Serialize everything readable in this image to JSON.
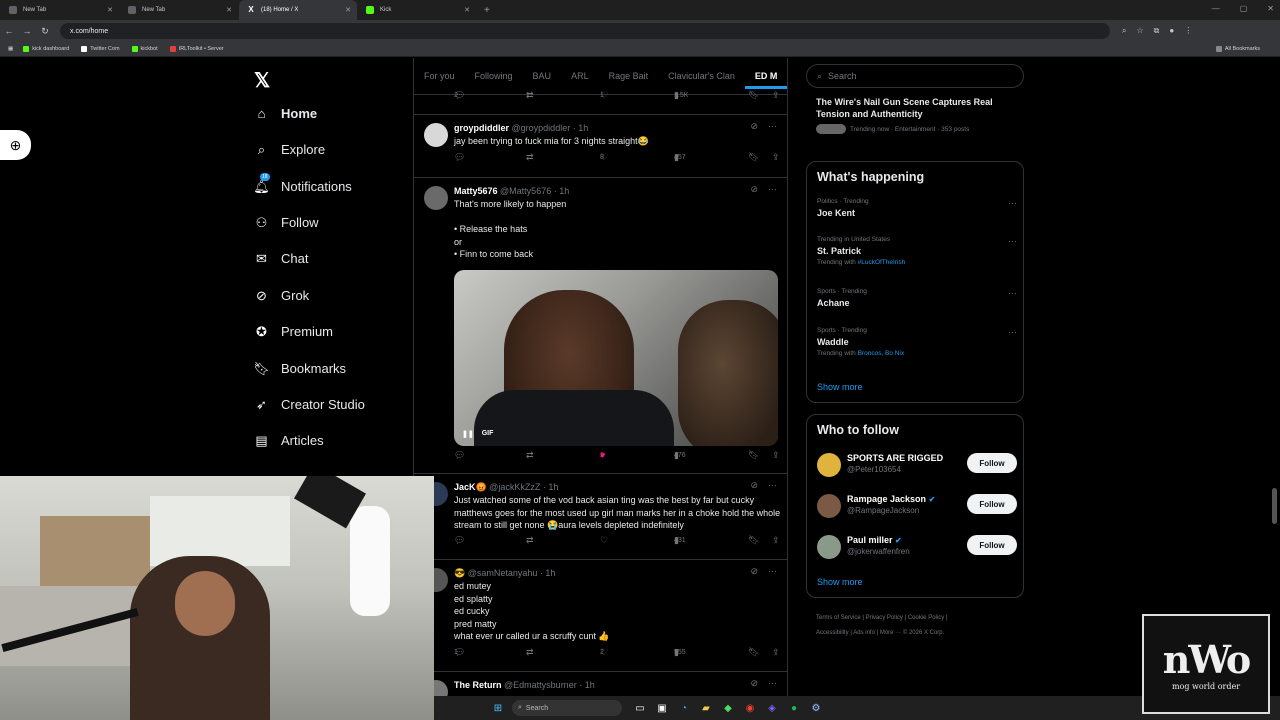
{
  "browser": {
    "tabs": [
      {
        "title": "New Tab",
        "active": false
      },
      {
        "title": "New Tab",
        "active": false
      },
      {
        "title": "(18) Home / X",
        "active": true
      },
      {
        "title": "Kick",
        "active": false
      }
    ],
    "url": "x.com/home",
    "bookmarks": [
      "kick dashboard",
      "Twitter Com",
      "kickbot",
      "IRLToolkit • Server"
    ],
    "all_bookmarks": "All Bookmarks"
  },
  "nav": {
    "items": [
      {
        "label": "Home",
        "icon": "home-icon"
      },
      {
        "label": "Explore",
        "icon": "search-icon"
      },
      {
        "label": "Notifications",
        "icon": "bell-icon",
        "badge": "18"
      },
      {
        "label": "Follow",
        "icon": "add-person-icon"
      },
      {
        "label": "Chat",
        "icon": "mail-icon"
      },
      {
        "label": "Grok",
        "icon": "grok-icon"
      },
      {
        "label": "Premium",
        "icon": "verified-icon"
      },
      {
        "label": "Bookmarks",
        "icon": "bookmark-icon"
      },
      {
        "label": "Creator Studio",
        "icon": "rocket-icon"
      },
      {
        "label": "Articles",
        "icon": "article-icon"
      }
    ]
  },
  "timeline": {
    "tabs": [
      "For you",
      "Following",
      "BAU",
      "ARL",
      "Rage Bait",
      "Clavicular's Clan",
      "ED M"
    ],
    "top_actions": {
      "replies": "2",
      "reposts": "1",
      "likes": "1",
      "views": "1.5K"
    },
    "posts": [
      {
        "name": "groypdiddler",
        "handle": "@groypdiddler · 1h",
        "text": "jay been trying to fuck mia for 3 nights straight😂",
        "replies": "",
        "reposts": "",
        "likes": "8",
        "views": "457"
      },
      {
        "name": "Matty5676",
        "handle": "@Matty5676 · 1h",
        "lines": [
          "That's more likely to happen",
          "",
          "• Release the hats",
          "or",
          "• Finn to come back"
        ],
        "gif_label": "GIF",
        "replies": "",
        "reposts": "",
        "likes": "2",
        "views": "476"
      },
      {
        "name": "JacK😡",
        "handle": "@jackKkZzZ · 1h",
        "text": "Just watched some of the vod back asian ting was the best by far but cucky matthews goes for the most used up girl man marks her in a choke hold the whole stream to still get none 😭aura levels depleted indefinitely",
        "replies": "",
        "reposts": "",
        "likes": "",
        "views": "431"
      },
      {
        "name": "😎",
        "handle": "@samNetanyahu · 1h",
        "lines": [
          "ed mutey",
          "ed splatty",
          "ed cucky",
          "pred matty",
          "what ever ur called ur a scruffy cunt 👍"
        ],
        "replies": "1",
        "reposts": "",
        "likes": "2",
        "views": "555"
      },
      {
        "name": "The Return",
        "handle": "@Edmattysburner · 1h"
      }
    ]
  },
  "sidebar": {
    "search_placeholder": "Search",
    "top_story": {
      "title": "The Wire's Nail Gun Scene Captures Real Tension and Authenticity",
      "meta": "Trending now · Entertainment · 353 posts"
    },
    "happening": {
      "heading": "What's happening",
      "trends": [
        {
          "meta": "Politics · Trending",
          "name": "Joe Kent",
          "with": "",
          "tags": ""
        },
        {
          "meta": "Trending in United States",
          "name": "St. Patrick",
          "with": "Trending with",
          "tags": "#LuckOfTheIrish"
        },
        {
          "meta": "Sports · Trending",
          "name": "Achane",
          "with": "",
          "tags": ""
        },
        {
          "meta": "Sports · Trending",
          "name": "Waddle",
          "with": "Trending with",
          "tags": "Broncos, Bo Nix"
        }
      ],
      "show_more": "Show more"
    },
    "who_to_follow": {
      "heading": "Who to follow",
      "accounts": [
        {
          "name": "SPORTS ARE RIGGED",
          "handle": "@Peter103654",
          "verified": false,
          "button": "Follow"
        },
        {
          "name": "Rampage Jackson",
          "handle": "@RampageJackson",
          "verified": true,
          "button": "Follow"
        },
        {
          "name": "Paul miller",
          "handle": "@jokerwaffenfren",
          "verified": true,
          "button": "Follow"
        }
      ],
      "show_more": "Show more"
    },
    "footer": {
      "line1": [
        "Terms of Service",
        "Privacy Policy",
        "Cookie Policy"
      ],
      "line2": [
        "Accessibility",
        "Ads info",
        "More ···",
        "© 2026 X Corp."
      ]
    }
  },
  "taskbar": {
    "search": "Search"
  },
  "overlay": {
    "logo_big": "nWo",
    "logo_small": "mog world order"
  },
  "colors": {
    "accent": "#1d9bf0",
    "like": "#f91880",
    "bg": "#000000",
    "border": "#2f3336"
  }
}
